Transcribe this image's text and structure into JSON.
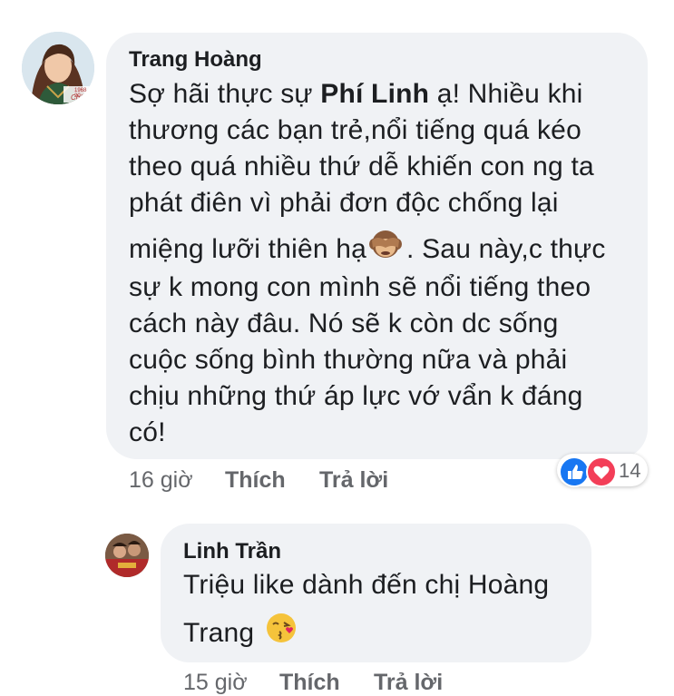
{
  "comment1": {
    "author": "Trang Hoàng",
    "text_segments": {
      "line1_pre": "Sợ hãi thực sự ",
      "line1_bold": "Phí Linh",
      "line1_post": " ạ! Nhiều khi",
      "line2": "thương các bạn trẻ,nổi tiếng quá kéo",
      "line3": "theo quá nhiều thứ dễ khiến con ng ta",
      "line4": "phát điên vì phải đơn độc chống lại",
      "line5_pre": "miệng lưỡi thiên hạ",
      "line5_post": ". Sau này,c thực",
      "line6": "sự k mong con mình sẽ nổi tiếng theo",
      "line7": "cách này đâu. Nó sẽ k còn dc sống",
      "line8": "cuộc sống bình thường nữa và phải",
      "line9": "chịu những thứ áp lực vớ vẩn k đáng",
      "line10": "có!"
    },
    "time": "16 giờ",
    "like_label": "Thích",
    "reply_label": "Trả lời",
    "reaction_count": "14",
    "avatar_badge": "Chí Vă",
    "avatar_year": "1968-20"
  },
  "comment2": {
    "author": "Linh Trần",
    "line1": "Triệu like dành đến chị Hoàng",
    "line2": "Trang",
    "time": "15 giờ",
    "like_label": "Thích",
    "reply_label": "Trả lời"
  },
  "icons": {
    "monkey": "see-no-evil-monkey-icon",
    "kiss": "face-blowing-kiss-icon",
    "like": "thumbs-up-icon",
    "love": "heart-icon"
  },
  "colors": {
    "bubble": "#f0f2f5",
    "meta": "#65676b",
    "like_blue": "#1877f2",
    "love_red": "#f33e58"
  }
}
